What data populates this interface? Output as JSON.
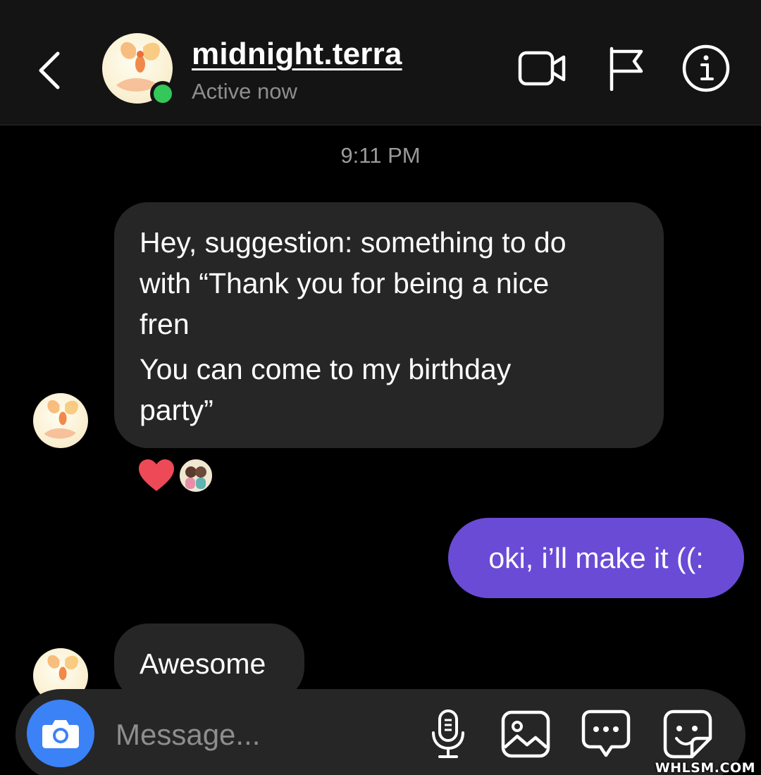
{
  "header": {
    "username": "midnight.terra",
    "status": "Active now",
    "icons": {
      "back": "back-chevron-icon",
      "video": "video-call-icon",
      "flag": "flag-icon",
      "info": "info-icon"
    }
  },
  "conversation": {
    "timestamp": "9:11 PM",
    "messages": [
      {
        "direction": "incoming",
        "lines": [
          "Hey, suggestion: something to do",
          "with “Thank you for being a nice",
          "fren",
          "You can come to my birthday",
          "party”"
        ],
        "reactions": [
          "heart",
          "reactor-avatar"
        ]
      },
      {
        "direction": "outgoing",
        "text": "oki, i’ll make it ((:"
      },
      {
        "direction": "incoming",
        "text": "Awesome"
      }
    ]
  },
  "composer": {
    "placeholder": "Message...",
    "icons": [
      "camera-icon",
      "microphone-icon",
      "gallery-icon",
      "chat-bubble-icon",
      "sticker-icon"
    ]
  },
  "colors": {
    "background": "#000000",
    "header": "#141414",
    "incoming_bubble": "#262626",
    "outgoing_bubble": "#6a4bd6",
    "online": "#34c759",
    "camera_button": "#3b82f6",
    "heart": "#ed4956"
  },
  "watermark": "WHLSM.COM"
}
